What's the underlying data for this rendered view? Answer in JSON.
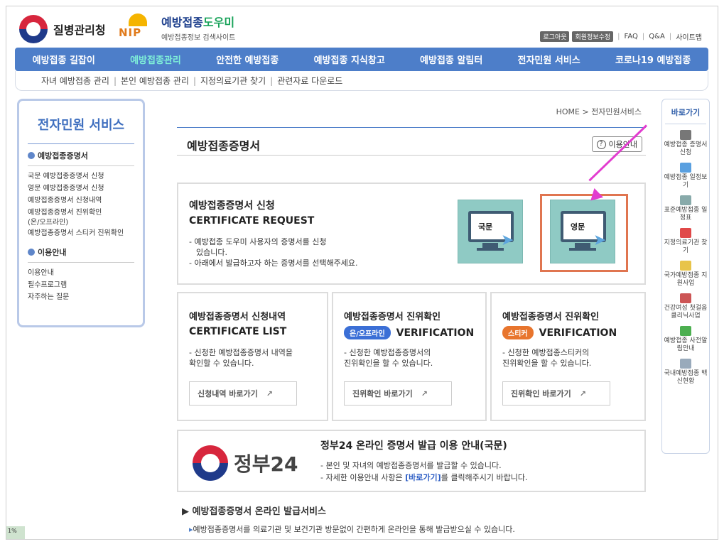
{
  "header": {
    "org_name": "질병관리청",
    "nip_logo": "NIP",
    "site_title_a": "예방접종",
    "site_title_b": "도우미",
    "site_subtitle": "예방접종정보 검색사이트",
    "util": {
      "logout": "로그아웃",
      "member_info": "회원정보수정",
      "faq": "FAQ",
      "qa": "Q&A",
      "sitemap": "사이트맵"
    }
  },
  "nav": {
    "items": [
      "예방접종 길잡이",
      "예방접종관리",
      "안전한 예방접종",
      "예방접종 지식창고",
      "예방접종 알림터",
      "전자민원 서비스",
      "코로나19 예방접종"
    ]
  },
  "subnav": {
    "items": [
      "자녀 예방접종 관리",
      "본인 예방접종 관리",
      "지정의료기관 찾기",
      "관련자료 다운로드"
    ]
  },
  "sidebar": {
    "title": "전자민원 서비스",
    "section1": "예방접종증명서",
    "links1": [
      "국문 예방접종증명서 신청",
      "영문 예방접종증명서 신청",
      "예방접종증명서 신청내역",
      "예방접종증명서 진위확인",
      "(온/오프라인)",
      "예방접종증명서 스티커 진위확인"
    ],
    "section2": "이용안내",
    "links2": [
      "이용안내",
      "필수프로그램",
      "자주하는 질문"
    ]
  },
  "content": {
    "breadcrumb": "HOME > 전자민원서비스",
    "page_title": "예방접종증명서",
    "info_button": "이용안내",
    "request": {
      "title": "예방접종증명서 신청",
      "title_en": "CERTIFICATE REQUEST",
      "desc1": "- 예방접종 도우미 사용자의 증명서를 신청",
      "desc2": "  있습니다.",
      "desc3": "- 아래에서 발급하고자 하는 증명서를 선택해주세요.",
      "btn_korean": "국문",
      "btn_english": "영문"
    },
    "cards": [
      {
        "title": "예방접종증명서 신청내역",
        "en": "CERTIFICATE LIST",
        "badge": "",
        "desc1": "- 신청한 예방접종증명서 내역을",
        "desc2": "   확인할 수 있습니다.",
        "link": "신청내역 바로가기"
      },
      {
        "title": "예방접종증명서 진위확인",
        "en": "VERIFICATION",
        "badge": "온/오프라인",
        "desc1": "- 신청한 예방접종증명서의",
        "desc2": "   진위확인을 할 수 있습니다.",
        "link": "진위확인 바로가기"
      },
      {
        "title": "예방접종증명서 진위확인",
        "en": "VERIFICATION",
        "badge": "스티커",
        "desc1": "- 신청한 예방접종스티커의",
        "desc2": "   진위확인을 할 수 있습니다.",
        "link": "진위확인 바로가기"
      }
    ],
    "gov24": {
      "logo": "정부24",
      "title": "정부24 온라인 증명서 발급 이용 안내(국문)",
      "desc1": "- 본인 및 자녀의 예방접종증명서를 발급할 수 있습니다.",
      "desc2_a": "- 자세한 이용안내 사항은 ",
      "desc2_link": "[바로가기]",
      "desc2_b": "를 클릭해주시기 바랍니다."
    },
    "bottom_heading": "예방접종증명서 온라인 발급서비스",
    "bottom_text": "예방접종증명서를 의료기관 및 보건기관 방문없이 간편하게 온라인을 통해 발급받으실 수 있습니다."
  },
  "quickbar": {
    "title": "바로가기",
    "items": [
      "예방접종 증명서 신청",
      "예방접종 일정보기",
      "표준예방접종 일정표",
      "지정의료기관 찾기",
      "국가예방접종 지원사업",
      "건강여성 첫걸음 클리닉사업",
      "예방접종 사전알림안내",
      "국내예방접종 백신현황"
    ]
  },
  "corner_tag": "1%",
  "colors": {
    "nav_bg": "#4d7ec9",
    "nav_active": "#7ff0d8",
    "highlight_border": "#e07550",
    "annotation_arrow": "#e23ccf",
    "badge_online": "#3b6fd6",
    "badge_sticker": "#e8752d"
  }
}
